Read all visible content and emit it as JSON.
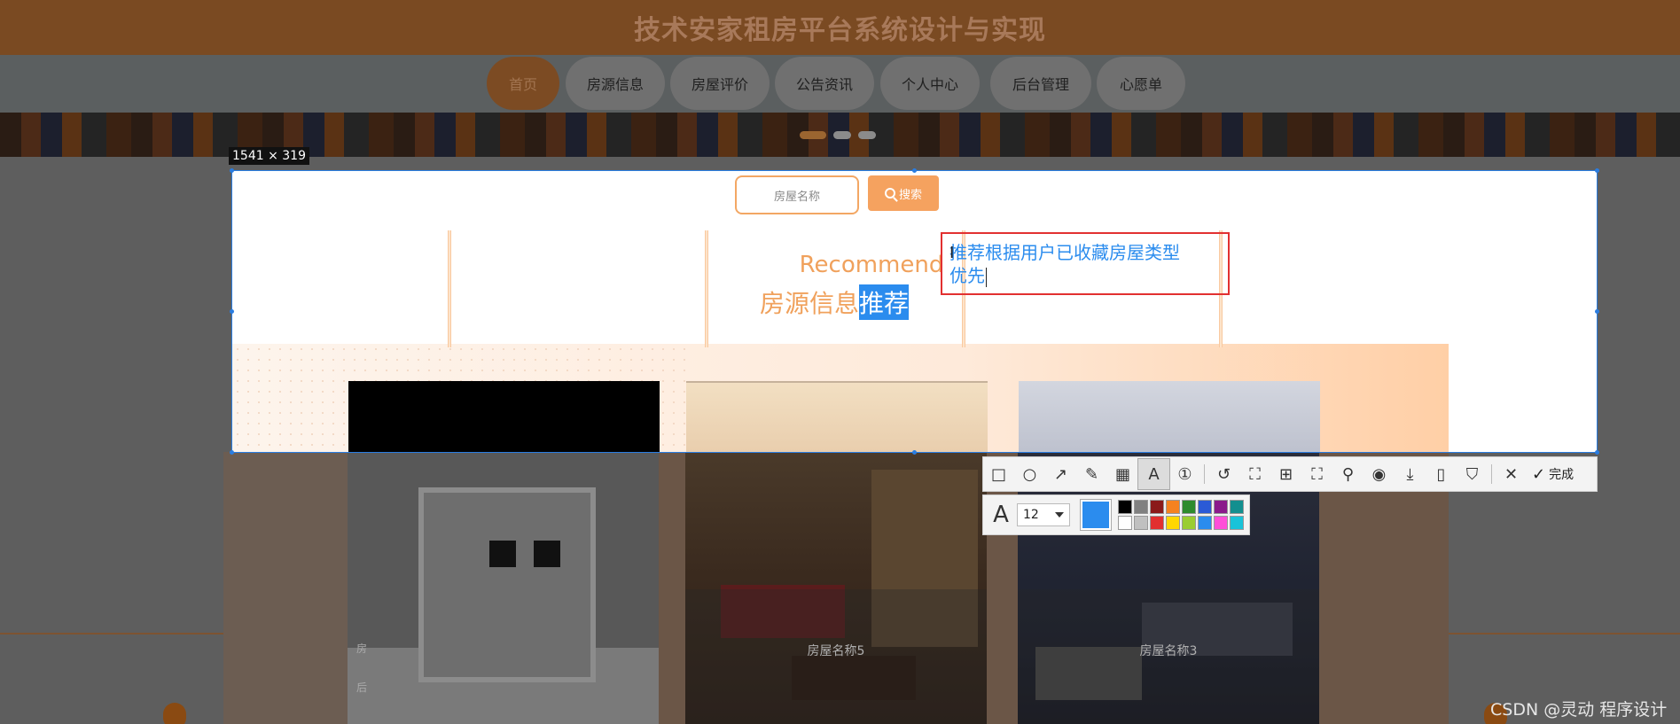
{
  "header": {
    "title": "技术安家租房平台系统设计与实现"
  },
  "nav": {
    "items": [
      {
        "label": "首页",
        "active": true
      },
      {
        "label": "房源信息"
      },
      {
        "label": "房屋评价"
      },
      {
        "label": "公告资讯"
      },
      {
        "label": "个人中心"
      },
      {
        "label": "后台管理"
      },
      {
        "label": "心愿单"
      }
    ]
  },
  "selection": {
    "size_label": "1541 × 319"
  },
  "search": {
    "placeholder": "房屋名称",
    "button_label": "搜索",
    "icon": "search-icon"
  },
  "recommend": {
    "en": "Recommend",
    "cn_plain": "房源信息",
    "cn_highlight": "推荐"
  },
  "annotation": {
    "line1": "推荐根据用户已收藏房屋类型",
    "line2": "优先",
    "caret_glyph": "I"
  },
  "cards": [
    {
      "caption_top": "房",
      "caption_bottom": "后"
    },
    {
      "caption": "房屋名称5"
    },
    {
      "caption": "房屋名称3"
    }
  ],
  "toolbar": {
    "tools": [
      {
        "name": "rectangle-tool",
        "glyph": "□"
      },
      {
        "name": "ellipse-tool",
        "glyph": "○"
      },
      {
        "name": "arrow-tool",
        "glyph": "↗"
      },
      {
        "name": "pencil-tool",
        "glyph": "✎"
      },
      {
        "name": "mosaic-tool",
        "glyph": "▦"
      },
      {
        "name": "text-tool",
        "glyph": "A",
        "active": true
      },
      {
        "name": "number-tool",
        "glyph": "①"
      },
      {
        "name": "undo-tool",
        "glyph": "↺"
      },
      {
        "name": "crop-tool",
        "glyph": "⛶"
      },
      {
        "name": "translate-tool",
        "glyph": "⊞"
      },
      {
        "name": "ocr-tool",
        "glyph": "⛶"
      },
      {
        "name": "pin-tool",
        "glyph": "⚲"
      },
      {
        "name": "record-tool",
        "glyph": "◉"
      },
      {
        "name": "download-tool",
        "glyph": "⤓"
      },
      {
        "name": "phone-tool",
        "glyph": "▯"
      },
      {
        "name": "bookmark-tool",
        "glyph": "⛉"
      },
      {
        "name": "close-tool",
        "glyph": "✕"
      }
    ],
    "done_label": "完成"
  },
  "propbar": {
    "font_glyph": "A",
    "font_size": "12",
    "current_color": "#2b8cee",
    "palette": [
      "#000000",
      "#808080",
      "#8b1a1a",
      "#f58220",
      "#2e8b2e",
      "#2b5ad6",
      "#8b1a8b",
      "#138f8f",
      "#ffffff",
      "#c0c0c0",
      "#e23030",
      "#ffd700",
      "#9acd32",
      "#2b8cee",
      "#ff4fd8",
      "#19c3d9"
    ]
  },
  "watermark": "CSDN @灵动 程序设计"
}
